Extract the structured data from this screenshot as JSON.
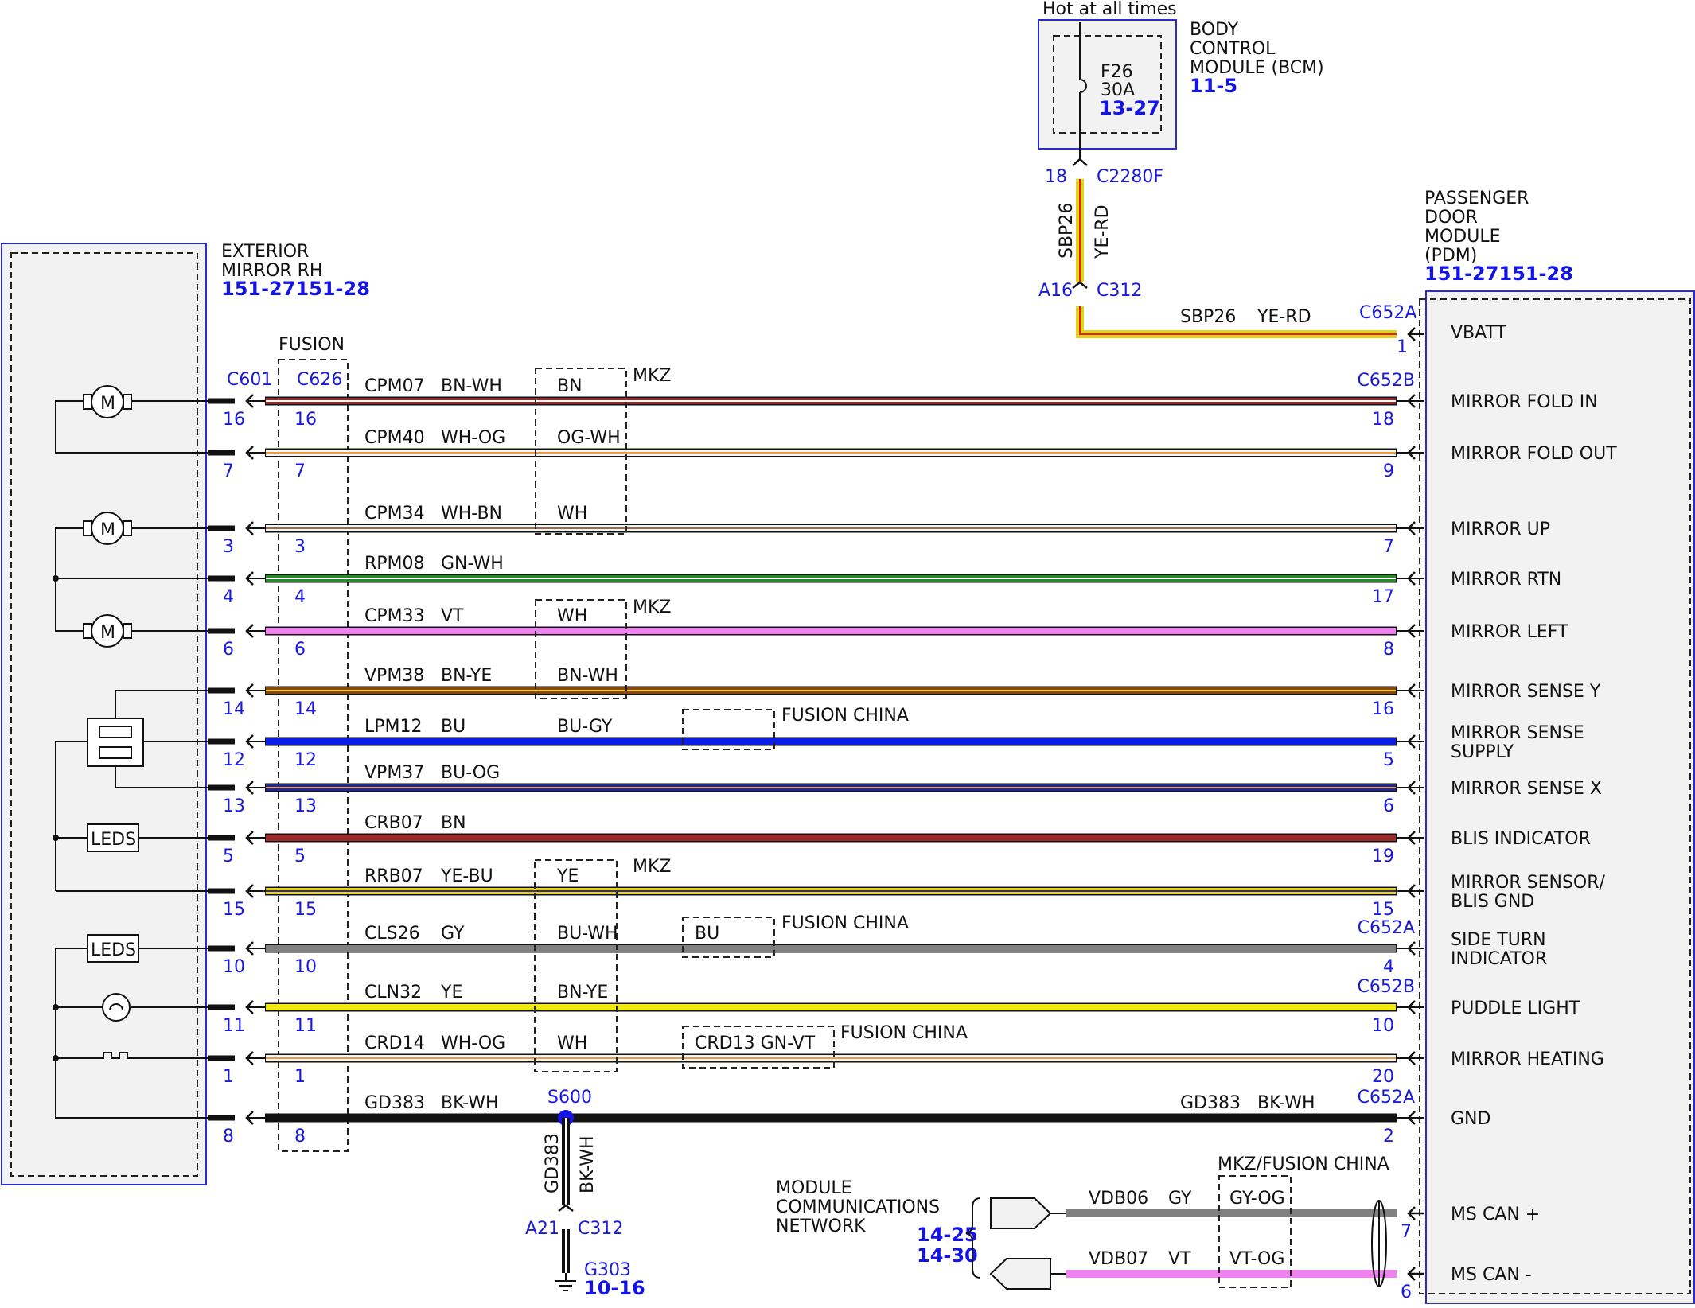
{
  "title_hot": "Hot at all times",
  "bcm": {
    "title_lines": [
      "BODY",
      "CONTROL",
      "MODULE (BCM)"
    ],
    "ref": "11-5",
    "fuse": "F26",
    "amps": "30A",
    "fuse_ref": "13-27",
    "pin": "18",
    "connector": "C2280F"
  },
  "feed": {
    "circuit": "SBP26",
    "color": "YE-RD",
    "inline_pin": "A16",
    "inline_conn": "C312",
    "pdm_circuit": "SBP26",
    "pdm_color": "YE-RD",
    "pdm_conn": "C652A",
    "pdm_pin": "1"
  },
  "mirror": {
    "title_lines": [
      "EXTERIOR",
      "MIRROR RH"
    ],
    "ref": "151-27151-28",
    "connector": "C601",
    "leds": "LEDS"
  },
  "fusion": {
    "label": "FUSION",
    "connector": "C626"
  },
  "pdm": {
    "title_lines": [
      "PASSENGER",
      "DOOR",
      "MODULE",
      "(PDM)"
    ],
    "ref": "151-27151-28"
  },
  "wires": [
    {
      "circuit": "CPM07",
      "color": "BN-WH",
      "c601": "16",
      "c626": "16",
      "pdm_conn": "C652B",
      "pdm_pin": "18",
      "func": [
        "MIRROR FOLD IN"
      ],
      "alt": "BN",
      "stroke": "#9b2a2a",
      "stroke2": "#ffffff"
    },
    {
      "circuit": "CPM40",
      "color": "WH-OG",
      "c601": "7",
      "c626": "7",
      "pdm_pin": "9",
      "func": [
        "MIRROR FOLD OUT"
      ],
      "alt": "OG-WH",
      "stroke": "#f5f5f5",
      "stroke2": "#ee9a3a"
    },
    {
      "circuit": "CPM34",
      "color": "WH-BN",
      "c601": "3",
      "c626": "3",
      "pdm_pin": "7",
      "func": [
        "MIRROR UP"
      ],
      "alt": "WH",
      "stroke": "#f5f5f5",
      "stroke2": "#9b6a4a"
    },
    {
      "circuit": "RPM08",
      "color": "GN-WH",
      "c601": "4",
      "c626": "4",
      "pdm_pin": "17",
      "func": [
        "MIRROR RTN"
      ],
      "alt": "",
      "stroke": "#1f8f1f",
      "stroke2": "#ffffff"
    },
    {
      "circuit": "CPM33",
      "color": "VT",
      "c601": "6",
      "c626": "6",
      "pdm_pin": "8",
      "func": [
        "MIRROR LEFT"
      ],
      "alt": "WH",
      "stroke": "#ee82ee",
      "stroke2": ""
    },
    {
      "circuit": "VPM38",
      "color": "BN-YE",
      "c601": "14",
      "c626": "14",
      "pdm_pin": "16",
      "func": [
        "MIRROR SENSE Y"
      ],
      "alt": "BN-WH",
      "stroke": "#8b4513",
      "stroke2": "#f0d020"
    },
    {
      "circuit": "LPM12",
      "color": "BU",
      "c601": "12",
      "c626": "12",
      "pdm_pin": "5",
      "func": [
        "MIRROR SENSE",
        "SUPPLY"
      ],
      "alt": "BU-GY",
      "stroke": "#0a1ee6",
      "stroke2": ""
    },
    {
      "circuit": "VPM37",
      "color": "BU-OG",
      "c601": "13",
      "c626": "13",
      "pdm_pin": "6",
      "func": [
        "MIRROR SENSE X"
      ],
      "alt": "",
      "stroke": "#1a2a9e",
      "stroke2": "#ee9a3a"
    },
    {
      "circuit": "CRB07",
      "color": "BN",
      "c601": "5",
      "c626": "5",
      "pdm_pin": "19",
      "func": [
        "BLIS INDICATOR"
      ],
      "alt": "",
      "stroke": "#9b2a2a",
      "stroke2": ""
    },
    {
      "circuit": "RRB07",
      "color": "YE-BU",
      "c601": "15",
      "c626": "15",
      "pdm_pin": "15",
      "func": [
        "MIRROR SENSOR/",
        "BLIS GND"
      ],
      "alt": "YE",
      "stroke": "#e6d21a",
      "stroke2": "#2a2ab0"
    },
    {
      "circuit": "CLS26",
      "color": "GY",
      "c601": "10",
      "c626": "10",
      "pdm_conn": "C652A",
      "pdm_pin": "4",
      "func": [
        "SIDE TURN",
        "INDICATOR"
      ],
      "alt": "BU-WH",
      "alt2": "BU",
      "stroke": "#808080",
      "stroke2": ""
    },
    {
      "circuit": "CLN32",
      "color": "YE",
      "c601": "11",
      "c626": "11",
      "pdm_conn": "C652B",
      "pdm_pin": "10",
      "func": [
        "PUDDLE LIGHT"
      ],
      "alt": "BN-YE",
      "stroke": "#f2ea10",
      "stroke2": ""
    },
    {
      "circuit": "CRD14",
      "color": "WH-OG",
      "c601": "1",
      "c626": "1",
      "pdm_pin": "20",
      "func": [
        "MIRROR HEATING"
      ],
      "alt": "WH",
      "alt2": "CRD13   GN-VT",
      "stroke": "#f5f5f5",
      "stroke2": "#ee9a3a"
    },
    {
      "circuit": "GD383",
      "color": "BK-WH",
      "c601": "8",
      "c626": "8",
      "pdm_conn": "C652A",
      "pdm_pin": "2",
      "func": [
        "GND"
      ],
      "alt": "",
      "stroke": "#111111",
      "stroke2": ""
    }
  ],
  "mkz": "MKZ",
  "fusion_china": "FUSION CHINA",
  "ground": {
    "splice": "S600",
    "circuit": "GD383",
    "color": "BK-WH",
    "pin": "A21",
    "conn": "C312",
    "gnd": "G303",
    "ref": "10-16",
    "pdm_circuit": "GD383",
    "pdm_color": "BK-WH"
  },
  "network": {
    "title_lines": [
      "MODULE",
      "COMMUNICATIONS",
      "NETWORK"
    ],
    "refs": [
      "14-25",
      "14-30"
    ],
    "option": "MKZ/FUSION CHINA",
    "lines": [
      {
        "circuit": "VDB06",
        "color": "GY",
        "alt": "GY-OG",
        "pin": "7",
        "func": "MS CAN +",
        "stroke": "#808080"
      },
      {
        "circuit": "VDB07",
        "color": "VT",
        "alt": "VT-OG",
        "pin": "6",
        "func": "MS CAN -",
        "stroke": "#ee82ee"
      }
    ]
  },
  "pdm_vbatt": "VBATT"
}
